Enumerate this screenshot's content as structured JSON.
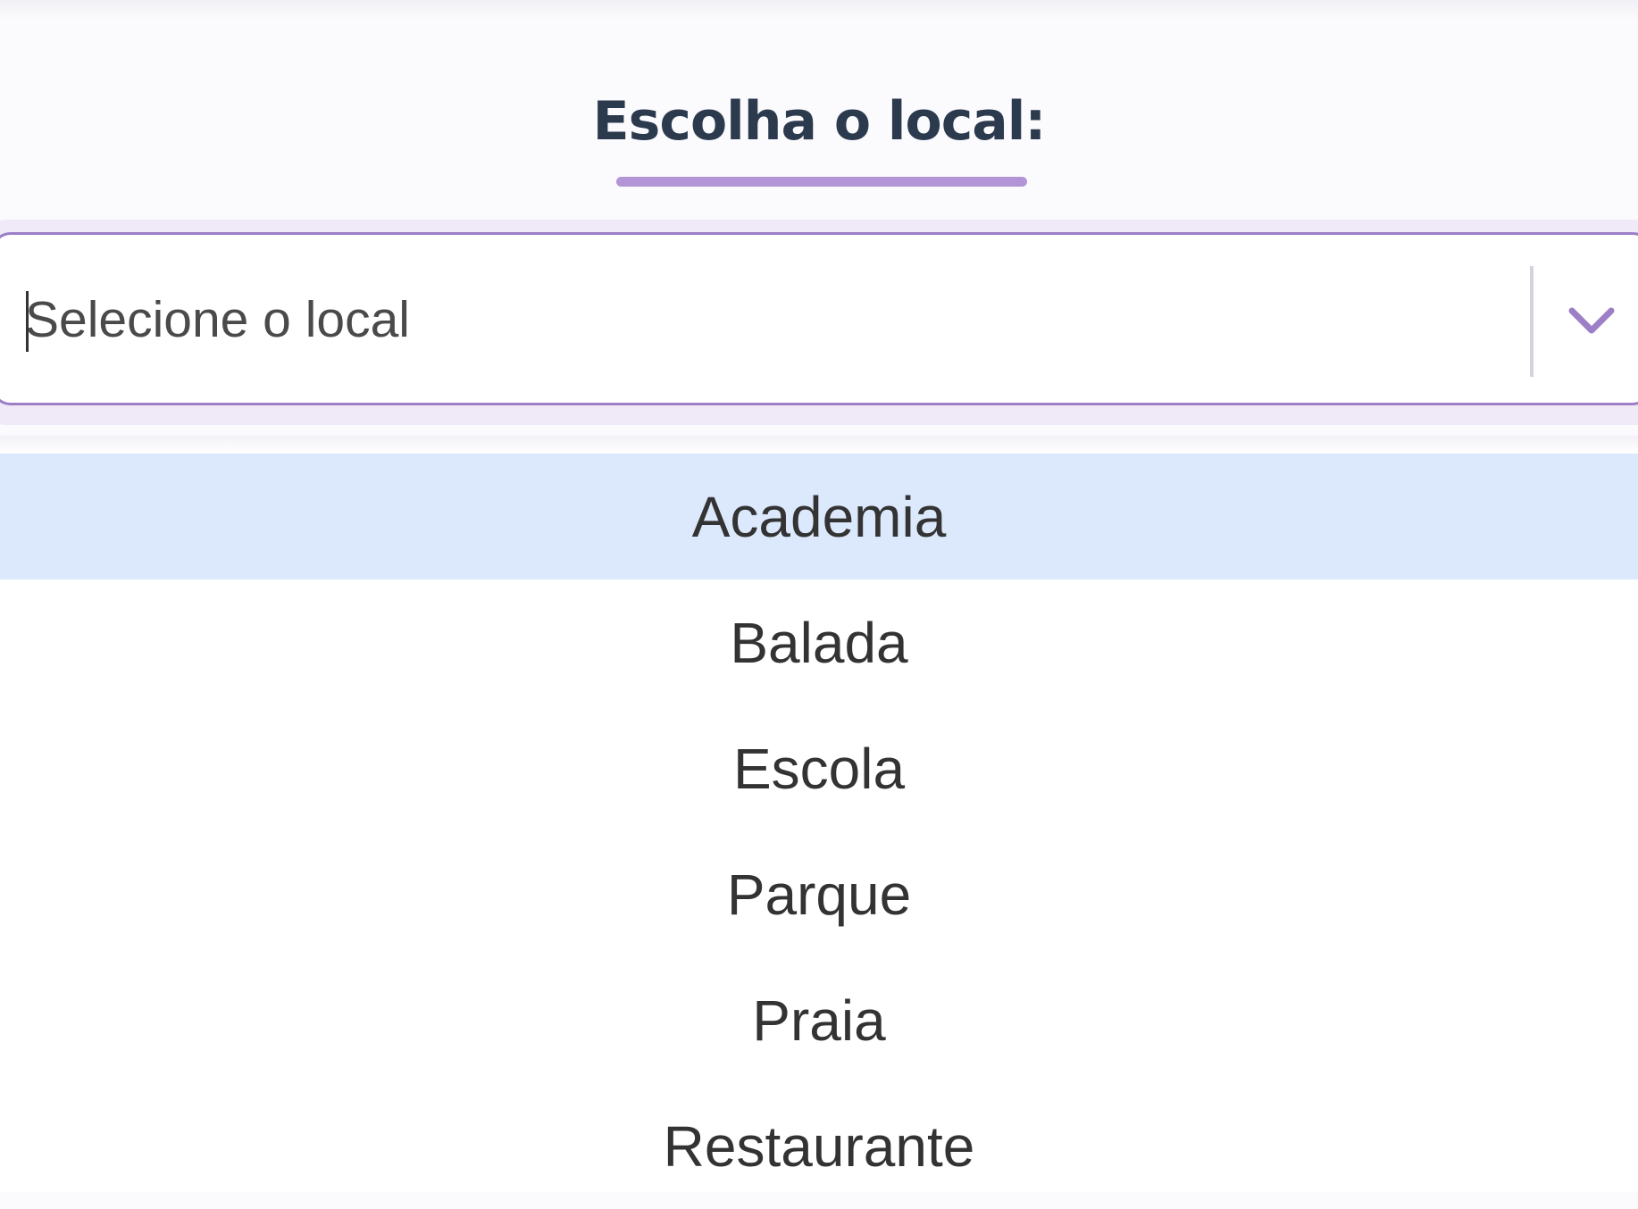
{
  "heading": {
    "label": "Escolha o local:"
  },
  "select": {
    "placeholder": "Selecione o local",
    "options": [
      {
        "label": "Academia",
        "highlighted": true
      },
      {
        "label": "Balada",
        "highlighted": false
      },
      {
        "label": "Escola",
        "highlighted": false
      },
      {
        "label": "Parque",
        "highlighted": false
      },
      {
        "label": "Praia",
        "highlighted": false
      },
      {
        "label": "Restaurante",
        "highlighted": false
      }
    ]
  },
  "colors": {
    "accent": "#b394d6",
    "border": "#9c7fc6",
    "highlight": "#dce8fc",
    "heading": "#2c3a4e"
  },
  "icons": {
    "dropdown": "chevron-down-icon"
  }
}
